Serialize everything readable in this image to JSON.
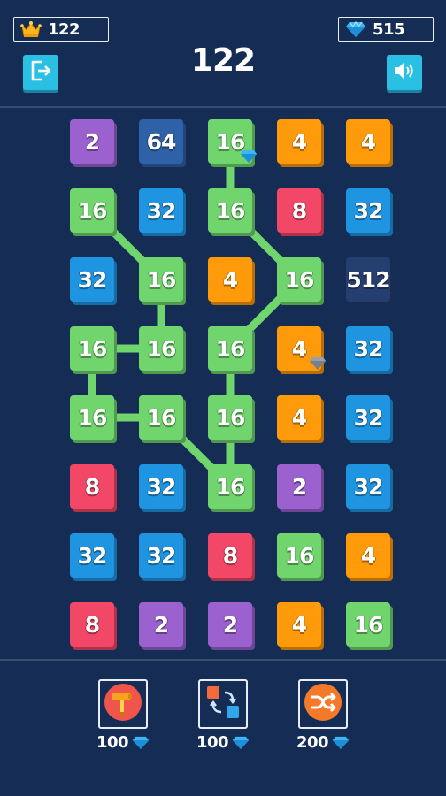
{
  "header": {
    "best_score": "122",
    "gems": "515",
    "score": "122",
    "best_icon": "crown-icon",
    "gem_icon": "diamond-icon",
    "exit_icon": "exit-icon",
    "sound_icon": "speaker-icon"
  },
  "colors": {
    "background": "#152d55",
    "tile_2": "#9a61cf",
    "tile_4": "#ff9a0a",
    "tile_8": "#f24766",
    "tile_16": "#6fd56c",
    "tile_32": "#1f95e2",
    "tile_64": "#2f61a8",
    "tile_512": "#243f6f",
    "link": "#6fd56c"
  },
  "board": {
    "rows": [
      [
        "2",
        "64",
        "16",
        "4",
        "4"
      ],
      [
        "16",
        "32",
        "16",
        "8",
        "32"
      ],
      [
        "32",
        "16",
        "4",
        "16",
        "512"
      ],
      [
        "16",
        "16",
        "16",
        "4",
        "32"
      ],
      [
        "16",
        "16",
        "16",
        "4",
        "32"
      ],
      [
        "8",
        "32",
        "16",
        "2",
        "32"
      ],
      [
        "32",
        "32",
        "8",
        "16",
        "4"
      ],
      [
        "8",
        "2",
        "2",
        "4",
        "16"
      ]
    ],
    "gem_tiles": [
      [
        0,
        2,
        "blue"
      ],
      [
        3,
        3,
        "grey"
      ]
    ],
    "chain_paths": [
      [
        [
          0,
          2
        ],
        [
          1,
          2
        ],
        [
          2,
          3
        ],
        [
          3,
          2
        ],
        [
          4,
          2
        ],
        [
          5,
          2
        ]
      ],
      [
        [
          1,
          0
        ],
        [
          2,
          1
        ],
        [
          3,
          1
        ],
        [
          3,
          0
        ],
        [
          4,
          0
        ],
        [
          4,
          1
        ],
        [
          5,
          2
        ]
      ]
    ]
  },
  "tools": [
    {
      "id": "hammer",
      "icon": "hammer-icon",
      "price": "100"
    },
    {
      "id": "swap",
      "icon": "swap-icon",
      "price": "100"
    },
    {
      "id": "shuffle",
      "icon": "shuffle-icon",
      "price": "200"
    }
  ]
}
